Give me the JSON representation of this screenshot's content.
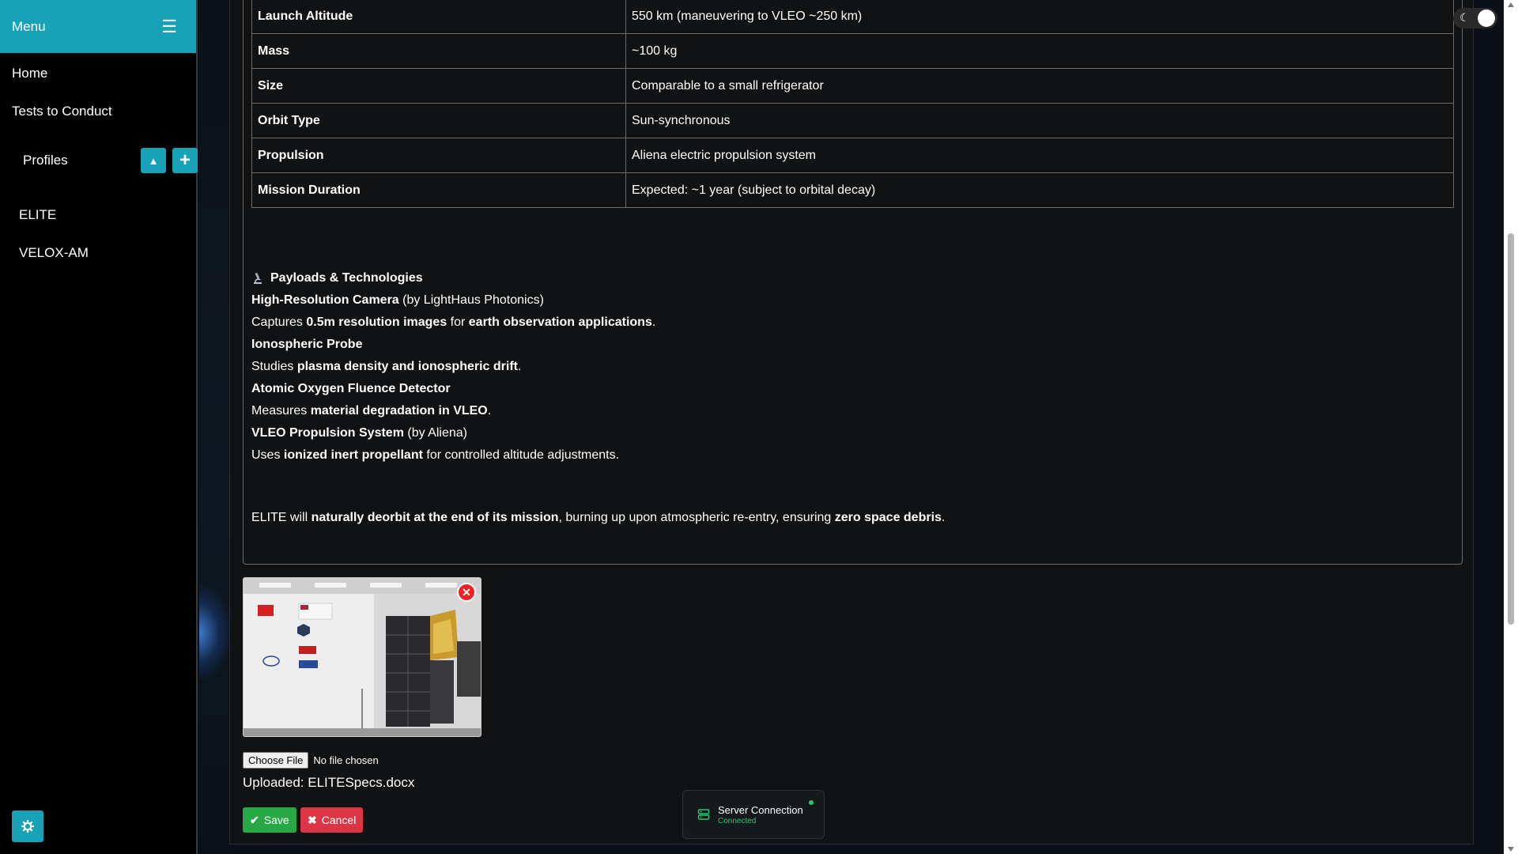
{
  "sidebar": {
    "title": "Menu",
    "nav": [
      {
        "label": "Home"
      },
      {
        "label": "Tests to Conduct"
      }
    ],
    "profiles_label": "Profiles",
    "profiles": [
      {
        "label": "ELITE"
      },
      {
        "label": "VELOX-AM"
      }
    ]
  },
  "specs": [
    {
      "key": "Launch Altitude",
      "value": "550 km (maneuvering to VLEO ~250 km)"
    },
    {
      "key": "Mass",
      "value": "~100 kg"
    },
    {
      "key": "Size",
      "value": "Comparable to a small refrigerator"
    },
    {
      "key": "Orbit Type",
      "value": "Sun-synchronous"
    },
    {
      "key": "Propulsion",
      "value": "Aliena electric propulsion system"
    },
    {
      "key": "Mission Duration",
      "value": "Expected: ~1 year (subject to orbital decay)"
    }
  ],
  "payloads": {
    "heading": "Payloads & Technologies",
    "items": [
      {
        "name": "High-Resolution Camera",
        "by": " (by LightHaus Photonics)",
        "desc": {
          "a": "Captures ",
          "b": "0.5m resolution images",
          "c": " for ",
          "d": "earth observation applications",
          "e": "."
        }
      },
      {
        "name": "Ionospheric Probe",
        "by": "",
        "desc": {
          "a": "Studies ",
          "b": "plasma density and ionospheric drift",
          "c": ".",
          "d": "",
          "e": ""
        }
      },
      {
        "name": "Atomic Oxygen Fluence Detector",
        "by": "",
        "desc": {
          "a": "Measures ",
          "b": "material degradation in VLEO",
          "c": ".",
          "d": "",
          "e": ""
        }
      },
      {
        "name": "VLEO Propulsion System",
        "by": " (by Aliena)",
        "desc": {
          "a": "Uses ",
          "b": "ionized inert propellant",
          "c": " for controlled altitude adjustments.",
          "d": "",
          "e": ""
        }
      }
    ]
  },
  "closing": {
    "a": "ELITE will ",
    "b": "naturally deorbit at the end of its mission",
    "c": ", burning up upon atmospheric re-entry, ensuring ",
    "d": "zero space debris",
    "e": "."
  },
  "image_remove_glyph": "✕",
  "file_input": {
    "button": "Choose File",
    "status": "No file chosen"
  },
  "uploaded": "Uploaded: ELITESpecs.docx",
  "buttons": {
    "save": "Save",
    "cancel": "Cancel",
    "save_icon": "check-icon",
    "cancel_icon": "x-icon"
  },
  "toast": {
    "title": "Server Connection",
    "status": "Connected"
  },
  "colors": {
    "accent": "#17a2b8",
    "save": "#28a745",
    "cancel": "#dc3545",
    "connected": "#28c76f"
  }
}
